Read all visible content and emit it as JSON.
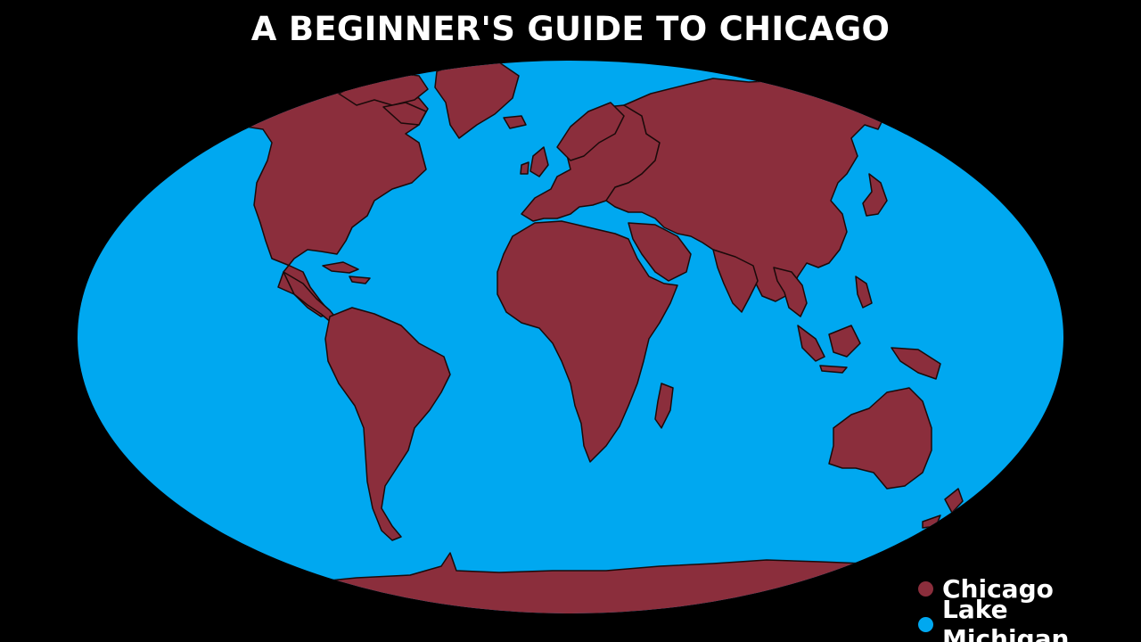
{
  "title": "A BEGINNER'S GUIDE TO CHICAGO",
  "colors": {
    "background": "#000000",
    "land": "#8b2e3c",
    "water": "#00a8f0",
    "outline": "#1a0a0a",
    "text": "#ffffff"
  },
  "map": {
    "projection": "world-map-oval",
    "land_label": "Chicago",
    "water_label": "Lake Michigan"
  },
  "legend": {
    "items": [
      {
        "label": "Chicago",
        "color": "#8b2e3c",
        "icon": "circle-marker-icon"
      },
      {
        "label": "Lake Michigan",
        "color": "#00a8f0",
        "icon": "circle-marker-icon"
      }
    ]
  }
}
